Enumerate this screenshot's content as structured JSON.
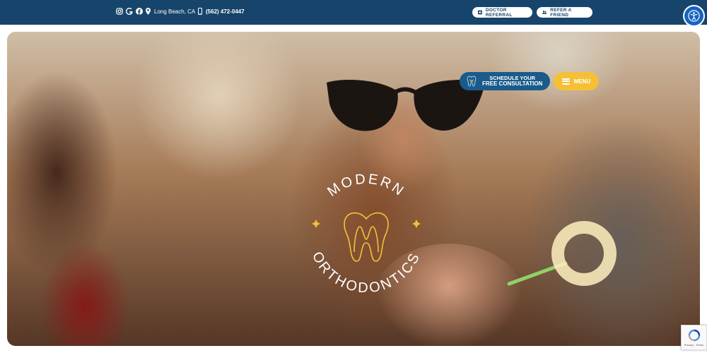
{
  "topbar": {
    "social": [
      {
        "name": "instagram-icon"
      },
      {
        "name": "google-icon"
      },
      {
        "name": "facebook-icon"
      }
    ],
    "location": "Long Beach, CA",
    "phone": "(562) 472-0447",
    "doctor_referral": "DOCTOR REFERRAL",
    "refer_friend": "REFER A FRIEND"
  },
  "hero": {
    "cta_line1": "SCHEDULE YOUR",
    "cta_line2": "FREE CONSULTATION",
    "menu_label": "MENU",
    "logo_top": "MODERN",
    "logo_bottom": "ORTHODONTICS"
  },
  "recaptcha": {
    "text": "Privacy - Terms"
  },
  "colors": {
    "topbar": "#17446b",
    "cta": "#1a5b8c",
    "menu": "#f5c036",
    "accessibility": "#1565c0",
    "logo_line": "#ffffff",
    "logo_accent": "#f5c036"
  }
}
